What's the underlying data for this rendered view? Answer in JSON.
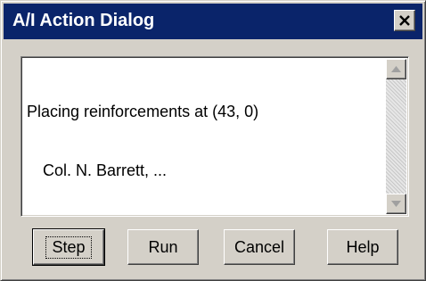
{
  "window": {
    "title": "A/I Action Dialog",
    "close_glyph": "✕"
  },
  "log": {
    "lines": [
      "Placing reinforcements at (43, 0)",
      "Col. N. Barrett, ..."
    ]
  },
  "scrollbar": {
    "up_icon": "triangle-up",
    "down_icon": "triangle-down"
  },
  "buttons": {
    "step": "Step",
    "run": "Run",
    "cancel": "Cancel",
    "help": "Help"
  }
}
